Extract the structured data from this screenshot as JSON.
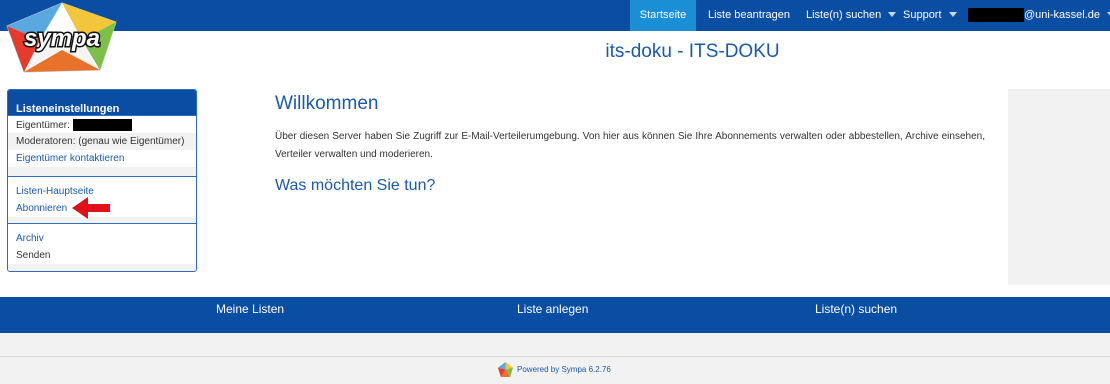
{
  "nav": {
    "home": "Startseite",
    "request_list": "Liste beantragen",
    "search_lists": "Liste(n) suchen",
    "support": "Support",
    "user_domain": "@uni-kassel.de"
  },
  "logo": {
    "text": "sympa"
  },
  "list_title": "its-doku - ITS-DOKU",
  "sidebar": {
    "header": "Listeneinstellungen",
    "owners_label": "Eigentümer:",
    "moderators": "Moderatoren: (genau wie Eigentümer)",
    "contact_owners": "Eigentümer kontaktieren",
    "list_home": "Listen-Hauptseite",
    "subscribe": "Abonnieren",
    "archive": "Archiv",
    "send": "Senden"
  },
  "main": {
    "heading": "Willkommen",
    "intro": "Über diesen Server haben Sie Zugriff zur E-Mail-Verteilerumgebung. Von hier aus können Sie Ihre Abonnements verwalten oder abbestellen, Archive einsehen, Verteiler verwalten und moderieren.",
    "subheading": "Was möchten Sie tun?"
  },
  "footer": {
    "my_lists": "Meine Listen",
    "create_list": "Liste anlegen",
    "search_lists": "Liste(n) suchen",
    "powered_by": "Powered by Sympa 6.2.76"
  },
  "colors": {
    "primary": "#0a4ea3",
    "active_tab": "#1b8fd6",
    "link": "#1a5aa8",
    "annotation_arrow": "#e0101a"
  }
}
